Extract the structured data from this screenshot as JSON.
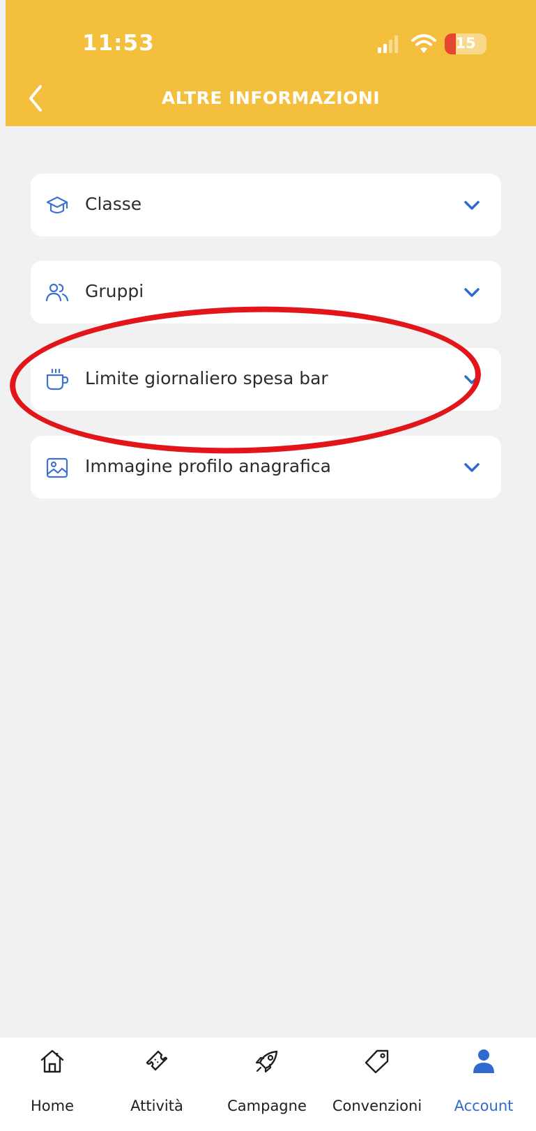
{
  "status_bar": {
    "time": "11:53",
    "battery": "15"
  },
  "header": {
    "title": "ALTRE INFORMAZIONI"
  },
  "sections": [
    {
      "label": "Classe",
      "icon": "graduation-cap-icon"
    },
    {
      "label": "Gruppi",
      "icon": "users-icon"
    },
    {
      "label": "Limite giornaliero spesa bar",
      "icon": "coffee-cup-icon"
    },
    {
      "label": "Immagine profilo anagrafica",
      "icon": "image-icon"
    }
  ],
  "tabbar": {
    "items": [
      {
        "label": "Home",
        "icon": "home-icon"
      },
      {
        "label": "Attività",
        "icon": "ticket-icon"
      },
      {
        "label": "Campagne",
        "icon": "rocket-icon"
      },
      {
        "label": "Convenzioni",
        "icon": "tag-icon"
      },
      {
        "label": "Account",
        "icon": "user-icon",
        "active": true
      }
    ]
  },
  "colors": {
    "header": "#f4bf3c",
    "accent": "#2f6bcf",
    "background": "#f1f1f2",
    "annotation": "#e2151a"
  }
}
